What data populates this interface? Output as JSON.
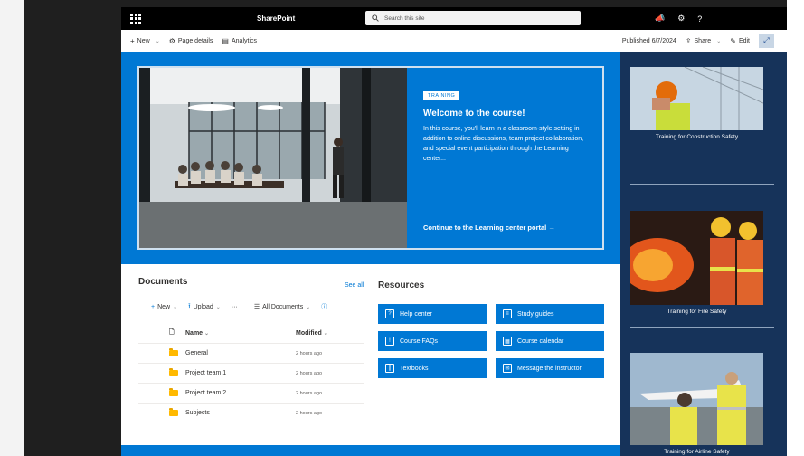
{
  "suitebar": {
    "app_name": "SharePoint",
    "search_placeholder": "Search this site"
  },
  "commandbar": {
    "new_label": "New",
    "page_details_label": "Page details",
    "analytics_label": "Analytics",
    "published_label": "Published 6/7/2024",
    "share_label": "Share",
    "edit_label": "Edit"
  },
  "hero": {
    "badge": "TRAINING",
    "title": "Welcome to the course!",
    "description": "In this course, you'll learn in a classroom-style setting in addition to online discussions, team project collaboration, and special event participation through the Learning center...",
    "link": "Continue to the Learning center portal →"
  },
  "sidebar": {
    "items": [
      {
        "caption": "Training for Construction Safety"
      },
      {
        "caption": "Training for Fire Safety"
      },
      {
        "caption": "Training for Airline Safety"
      }
    ]
  },
  "documents": {
    "title": "Documents",
    "see_all": "See all",
    "toolbar": {
      "new_label": "New",
      "upload_label": "Upload",
      "more_label": "···",
      "view_label": "All Documents"
    },
    "columns": {
      "name": "Name",
      "modified": "Modified"
    },
    "rows": [
      {
        "name": "General",
        "modified": "2 hours ago"
      },
      {
        "name": "Project team 1",
        "modified": "2 hours ago"
      },
      {
        "name": "Project team 2",
        "modified": "2 hours ago"
      },
      {
        "name": "Subjects",
        "modified": "2 hours ago"
      }
    ]
  },
  "resources": {
    "title": "Resources",
    "buttons": [
      {
        "label": "Help center",
        "icon": "help-icon"
      },
      {
        "label": "Study guides",
        "icon": "document-icon"
      },
      {
        "label": "Course FAQs",
        "icon": "faq-icon"
      },
      {
        "label": "Course calendar",
        "icon": "calendar-icon"
      },
      {
        "label": "Textbooks",
        "icon": "books-icon"
      },
      {
        "label": "Message the instructor",
        "icon": "mail-icon"
      }
    ]
  },
  "colors": {
    "brand_blue": "#0078d4",
    "sidebar_navy": "#16335a",
    "suitebar_black": "#000000"
  }
}
